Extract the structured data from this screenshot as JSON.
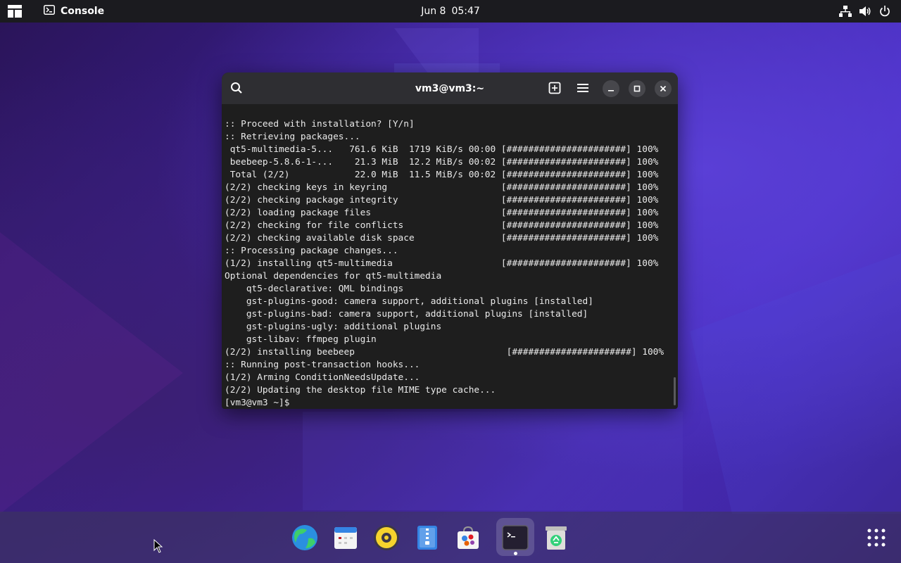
{
  "topbar": {
    "activities_icon": "activities-overview-icon",
    "app_icon": "terminal-icon",
    "app_name": "Console",
    "date": "Jun 8",
    "time": "05:47",
    "tray_icons": [
      "network-icon",
      "volume-icon",
      "power-icon"
    ]
  },
  "window": {
    "title": "vm3@vm3:~",
    "buttons": [
      "search-icon",
      "new-tab-icon",
      "hamburger-menu-icon",
      "minimize-icon",
      "maximize-icon",
      "close-icon"
    ]
  },
  "terminal": {
    "lines": [
      ":: Proceed with installation? [Y/n]",
      ":: Retrieving packages...",
      " qt5-multimedia-5...   761.6 KiB  1719 KiB/s 00:00 [######################] 100%",
      " beebeep-5.8.6-1-...    21.3 MiB  12.2 MiB/s 00:02 [######################] 100%",
      " Total (2/2)            22.0 MiB  11.5 MiB/s 00:02 [######################] 100%",
      "(2/2) checking keys in keyring                     [######################] 100%",
      "(2/2) checking package integrity                   [######################] 100%",
      "(2/2) loading package files                        [######################] 100%",
      "(2/2) checking for file conflicts                  [######################] 100%",
      "(2/2) checking available disk space                [######################] 100%",
      ":: Processing package changes...",
      "(1/2) installing qt5-multimedia                    [######################] 100%",
      "Optional dependencies for qt5-multimedia",
      "    qt5-declarative: QML bindings",
      "    gst-plugins-good: camera support, additional plugins [installed]",
      "    gst-plugins-bad: camera support, additional plugins [installed]",
      "    gst-plugins-ugly: additional plugins",
      "    gst-libav: ffmpeg plugin",
      "(2/2) installing beebeep                            [######################] 100%",
      ":: Running post-transaction hooks...",
      "(1/2) Arming ConditionNeedsUpdate...",
      "(2/2) Updating the desktop file MIME type cache...",
      "[vm3@vm3 ~]$ "
    ]
  },
  "dock": {
    "items": [
      {
        "name": "web-browser-icon",
        "active": false
      },
      {
        "name": "calendar-icon",
        "active": false
      },
      {
        "name": "music-player-icon",
        "active": false
      },
      {
        "name": "archive-manager-icon",
        "active": false
      },
      {
        "name": "software-store-icon",
        "active": false
      },
      {
        "name": "console-icon",
        "active": true
      },
      {
        "name": "trash-icon",
        "active": false
      }
    ],
    "app_grid_icon": "show-apps-icon"
  },
  "colors": {
    "accent": "#3584e4",
    "terminal_bg": "#1e1e1e",
    "headerbar_bg": "#2e2e32",
    "topbar_bg": "#1b1b1f"
  }
}
